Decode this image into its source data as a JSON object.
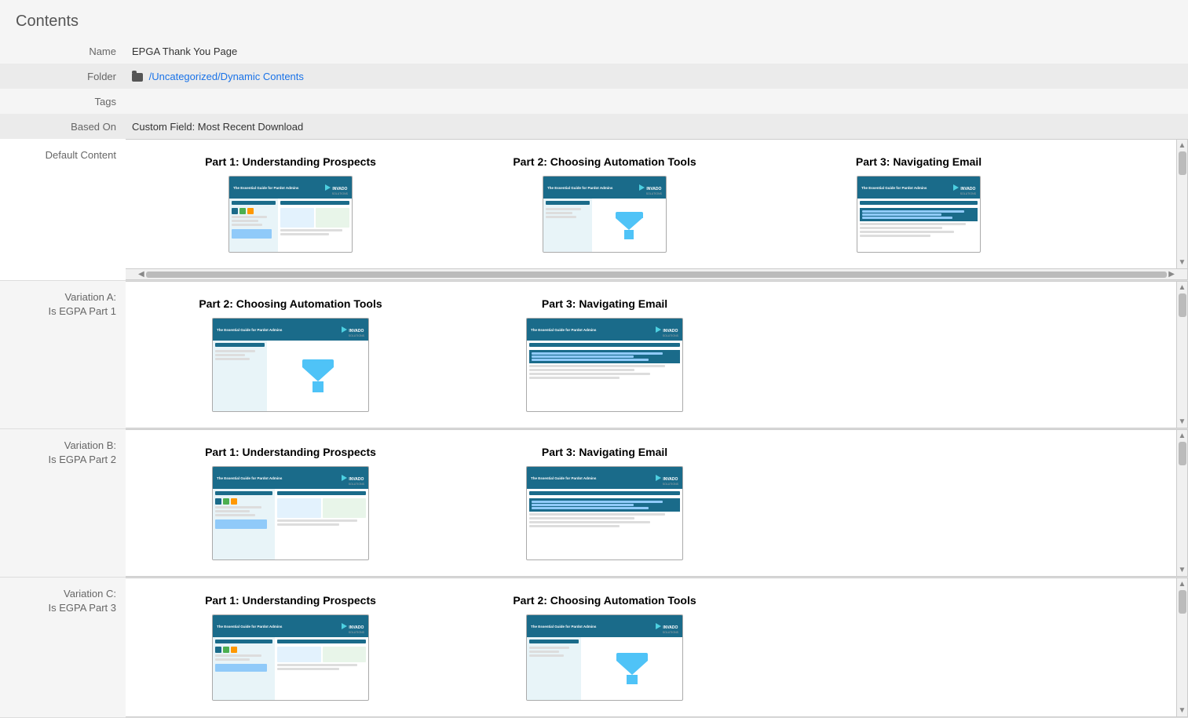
{
  "page": {
    "title": "Contents"
  },
  "metadata": {
    "name_label": "Name",
    "name_value": "EPGA Thank You Page",
    "folder_label": "Folder",
    "folder_path": "/Uncategorized/Dynamic Contents",
    "tags_label": "Tags",
    "tags_value": "",
    "based_on_label": "Based On",
    "based_on_value": "Custom Field: Most Recent Download",
    "default_content_label": "Default Content",
    "variation_a_label": "Variation A:\nIs EGPA Part 1",
    "variation_a_line1": "Variation A:",
    "variation_a_line2": "Is EGPA Part 1",
    "variation_b_label": "Variation B:\nIs EGPA Part 2",
    "variation_b_line1": "Variation B:",
    "variation_b_line2": "Is EGPA Part 2",
    "variation_c_label": "Variation C:\nIs EGPA Part 3",
    "variation_c_line1": "Variation C:",
    "variation_c_line2": "Is EGPA Part 3"
  },
  "cards": {
    "part1_title": "Part 1: Understanding Prospects",
    "part2_title": "Part 2: Choosing Automation Tools",
    "part3_title": "Part 3: Navigating Email"
  },
  "default_content": {
    "items": [
      {
        "title": "Part 1: Understanding Prospects",
        "type": "prospects"
      },
      {
        "title": "Part 2: Choosing Automation Tools",
        "type": "automation"
      },
      {
        "title": "Part 3: Navigating Email",
        "type": "email"
      }
    ]
  },
  "variation_a": {
    "items": [
      {
        "title": "Part 2: Choosing Automation Tools",
        "type": "automation"
      },
      {
        "title": "Part 3: Navigating Email",
        "type": "email"
      }
    ]
  },
  "variation_b": {
    "items": [
      {
        "title": "Part 1: Understanding Prospects",
        "type": "prospects"
      },
      {
        "title": "Part 3: Navigating Email",
        "type": "email"
      }
    ]
  },
  "variation_c": {
    "items": [
      {
        "title": "Part 1: Understanding Prospects",
        "type": "prospects"
      },
      {
        "title": "Part 2: Choosing Automation Tools",
        "type": "automation"
      }
    ]
  }
}
